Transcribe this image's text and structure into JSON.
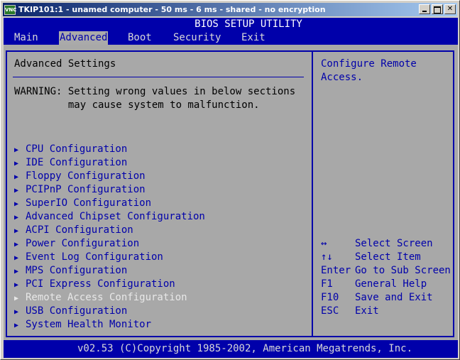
{
  "window": {
    "title": "TKIP101:1 - unamed computer - 50 ms - 6 ms - shared - no encryption",
    "icon_label": "VNC"
  },
  "bios": {
    "header": "BIOS SETUP UTILITY",
    "menu": [
      "Main",
      "Advanced",
      "Boot",
      "Security",
      "Exit"
    ],
    "active_menu": "Advanced",
    "section_title": "Advanced Settings",
    "warning_line1": "WARNING: Setting wrong values in below sections",
    "warning_line2": "         may cause system to malfunction.",
    "items": [
      "CPU Configuration",
      "IDE Configuration",
      "Floppy Configuration",
      "PCIPnP Configuration",
      "SuperIO Configuration",
      "Advanced Chipset Configuration",
      "ACPI Configuration",
      "Power Configuration",
      "Event Log Configuration",
      "MPS Configuration",
      "PCI Express Configuration",
      "Remote Access Configuration",
      "USB Configuration",
      "System Health Monitor"
    ],
    "selected_item": "Remote Access Configuration",
    "help_line1": "Configure Remote",
    "help_line2": "Access.",
    "keys": [
      {
        "key": "↔",
        "desc": "Select Screen"
      },
      {
        "key": "↑↓",
        "desc": "Select Item"
      },
      {
        "key": "Enter",
        "desc": "Go to Sub Screen"
      },
      {
        "key": "F1",
        "desc": "General Help"
      },
      {
        "key": "F10",
        "desc": "Save and Exit"
      },
      {
        "key": "ESC",
        "desc": "Exit"
      }
    ],
    "footer": "v02.53 (C)Copyright 1985-2002, American Megatrends, Inc."
  },
  "colors": {
    "bios_blue": "#0000aa",
    "panel_grey": "#a8a8a8",
    "highlight": "#e8e8e8"
  }
}
